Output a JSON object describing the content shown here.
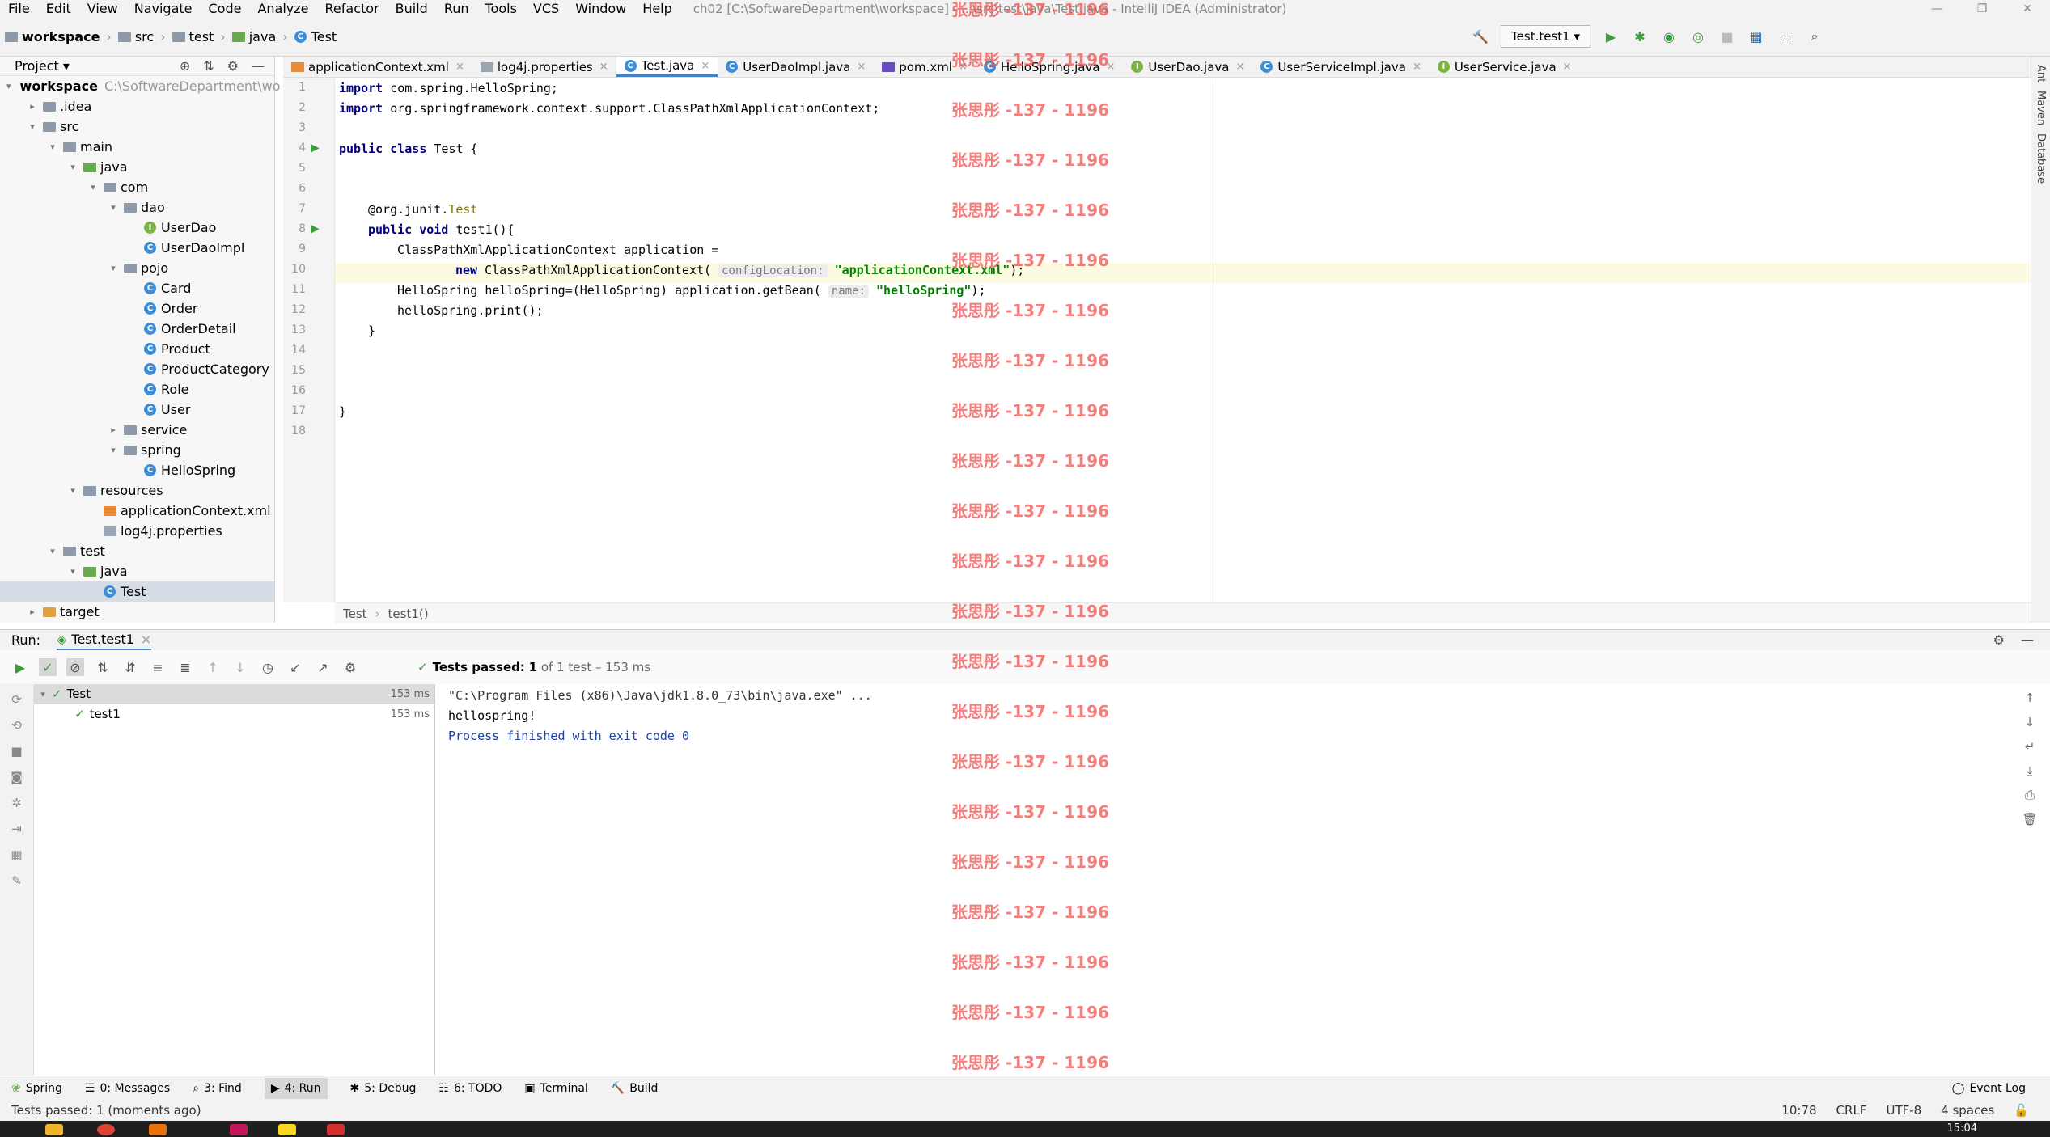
{
  "menu": [
    "File",
    "Edit",
    "View",
    "Navigate",
    "Code",
    "Analyze",
    "Refactor",
    "Build",
    "Run",
    "Tools",
    "VCS",
    "Window",
    "Help"
  ],
  "window_title": "ch02 [C:\\SoftwareDepartment\\workspace] - ...\\src\\test\\java\\Test.java - IntelliJ IDEA (Administrator)",
  "breadcrumb": [
    "workspace",
    "src",
    "test",
    "java",
    "Test"
  ],
  "run_config": "Test.test1",
  "project": {
    "header": "Project",
    "root_name": "workspace",
    "root_path": "C:\\SoftwareDepartment\\wo",
    "items": [
      {
        "label": "workspace",
        "depth": 0,
        "kind": "folder",
        "arrow": "▾"
      },
      {
        "label": ".idea",
        "depth": 1,
        "kind": "folder",
        "arrow": "▸"
      },
      {
        "label": "src",
        "depth": 1,
        "kind": "folder",
        "arrow": "▾"
      },
      {
        "label": "main",
        "depth": 2,
        "kind": "folder",
        "arrow": "▾"
      },
      {
        "label": "java",
        "depth": 3,
        "kind": "folder",
        "arrow": "▾"
      },
      {
        "label": "com",
        "depth": 4,
        "kind": "folder",
        "arrow": "▾"
      },
      {
        "label": "dao",
        "depth": 5,
        "kind": "folder",
        "arrow": "▾"
      },
      {
        "label": "UserDao",
        "depth": 6,
        "kind": "interface",
        "arrow": ""
      },
      {
        "label": "UserDaoImpl",
        "depth": 6,
        "kind": "class",
        "arrow": ""
      },
      {
        "label": "pojo",
        "depth": 5,
        "kind": "folder",
        "arrow": "▾"
      },
      {
        "label": "Card",
        "depth": 6,
        "kind": "class",
        "arrow": ""
      },
      {
        "label": "Order",
        "depth": 6,
        "kind": "class",
        "arrow": ""
      },
      {
        "label": "OrderDetail",
        "depth": 6,
        "kind": "class",
        "arrow": ""
      },
      {
        "label": "Product",
        "depth": 6,
        "kind": "class",
        "arrow": ""
      },
      {
        "label": "ProductCategory",
        "depth": 6,
        "kind": "class",
        "arrow": ""
      },
      {
        "label": "Role",
        "depth": 6,
        "kind": "class",
        "arrow": ""
      },
      {
        "label": "User",
        "depth": 6,
        "kind": "class",
        "arrow": ""
      },
      {
        "label": "service",
        "depth": 5,
        "kind": "folder",
        "arrow": "▸"
      },
      {
        "label": "spring",
        "depth": 5,
        "kind": "folder",
        "arrow": "▾"
      },
      {
        "label": "HelloSpring",
        "depth": 6,
        "kind": "class",
        "arrow": ""
      },
      {
        "label": "resources",
        "depth": 3,
        "kind": "folder",
        "arrow": "▾"
      },
      {
        "label": "applicationContext.xml",
        "depth": 4,
        "kind": "xml",
        "arrow": ""
      },
      {
        "label": "log4j.properties",
        "depth": 4,
        "kind": "props",
        "arrow": ""
      },
      {
        "label": "test",
        "depth": 2,
        "kind": "folder",
        "arrow": "▾"
      },
      {
        "label": "java",
        "depth": 3,
        "kind": "folder",
        "arrow": "▾"
      },
      {
        "label": "Test",
        "depth": 4,
        "kind": "class",
        "arrow": ""
      },
      {
        "label": "target",
        "depth": 1,
        "kind": "folder",
        "arrow": "▸"
      }
    ]
  },
  "tabs": [
    {
      "label": "applicationContext.xml",
      "active": false
    },
    {
      "label": "log4j.properties",
      "active": false
    },
    {
      "label": "Test.java",
      "active": true
    },
    {
      "label": "UserDaoImpl.java",
      "active": false
    },
    {
      "label": "pom.xml",
      "active": false
    },
    {
      "label": "HelloSpring.java",
      "active": false
    },
    {
      "label": "UserDao.java",
      "active": false
    },
    {
      "label": "UserServiceImpl.java",
      "active": false
    },
    {
      "label": "UserService.java",
      "active": false
    }
  ],
  "code": {
    "l1_kw": "import",
    "l1_rest": " com.spring.HelloSpring;",
    "l2_kw": "import",
    "l2_rest": " org.springframework.context.support.ClassPathXmlApplicationContext;",
    "l4_kw": "public class",
    "l4_rest": " Test {",
    "l7_at": "@org.junit.",
    "l7_ann": "Test",
    "l8_kw": "public void",
    "l8_rest": " test1(){",
    "l9": "ClassPathXmlApplicationContext application =",
    "l10_kw": "new",
    "l10_mid": " ClassPathXmlApplicationContext( ",
    "l10_hint": "configLocation:",
    "l10_str": "\"applicationContext.xml\"",
    "l10_end": ");",
    "l11_a": "HelloSpring helloSpring=(HelloSpring) application.getBean( ",
    "l11_hint": "name:",
    "l11_str": "\"helloSpring\"",
    "l11_end": ");",
    "l12": "helloSpring.print();",
    "l13": "}",
    "l17": "}",
    "line_numbers": [
      "1",
      "2",
      "3",
      "4",
      "5",
      "6",
      "7",
      "8",
      "9",
      "10",
      "11",
      "12",
      "13",
      "14",
      "15",
      "16",
      "17",
      "18"
    ]
  },
  "editor_breadcrumb": [
    "Test",
    "test1()"
  ],
  "run": {
    "label": "Run:",
    "tab": "Test.test1",
    "status_prefix": "Tests passed:",
    "status_count": "1",
    "status_rest": "of 1 test – 153 ms",
    "tree": [
      {
        "label": "Test",
        "time": "153 ms"
      },
      {
        "label": "test1",
        "time": "153 ms"
      }
    ],
    "console": [
      "\"C:\\Program Files (x86)\\Java\\jdk1.8.0_73\\bin\\java.exe\" ...",
      "hellospring!",
      "Process finished with exit code 0"
    ]
  },
  "toolwindows": [
    "Spring",
    "0: Messages",
    "3: Find",
    "4: Run",
    "5: Debug",
    "6: TODO",
    "Terminal",
    "Build"
  ],
  "event_log": "Event Log",
  "status": {
    "message": "Tests passed: 1 (moments ago)",
    "position": "10:78",
    "line_sep": "CRLF",
    "encoding": "UTF-8",
    "indent": "4 spaces"
  },
  "side_tools": [
    "Ant",
    "Maven",
    "Database"
  ],
  "clock": "15:04",
  "watermark": "张思彤 -137 - 1196",
  "colors": {
    "accent": "#4083c9",
    "pass": "#3e9a3e",
    "watermark": "#ef5350"
  }
}
